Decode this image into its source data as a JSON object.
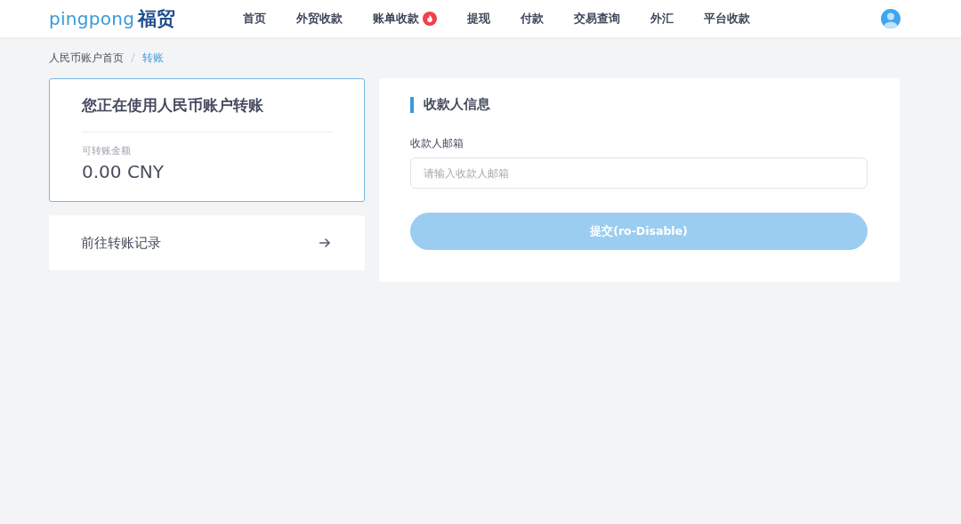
{
  "header": {
    "logo_latin": "pingpong",
    "logo_cjk": "福贸",
    "nav": [
      {
        "label": "首页",
        "hot": false
      },
      {
        "label": "外贸收款",
        "hot": false
      },
      {
        "label": "账单收款",
        "hot": true
      },
      {
        "label": "提现",
        "hot": false
      },
      {
        "label": "付款",
        "hot": false
      },
      {
        "label": "交易查询",
        "hot": false
      },
      {
        "label": "外汇",
        "hot": false
      },
      {
        "label": "平台收款",
        "hot": false
      }
    ]
  },
  "breadcrumb": [
    {
      "label": "人民币账户首页",
      "current": false
    },
    {
      "label": "转账",
      "current": true
    }
  ],
  "account_card": {
    "title": "您正在使用人民币账户转账",
    "balance_label": "可转账金额",
    "balance": "0.00 CNY"
  },
  "history_link": {
    "label": "前往转账记录"
  },
  "payee_form": {
    "title": "收款人信息",
    "email_label": "收款人邮箱",
    "email_placeholder": "请输入收款人邮箱",
    "submit": {
      "label": "提交(ro-Disable)",
      "disabled": true
    }
  }
}
